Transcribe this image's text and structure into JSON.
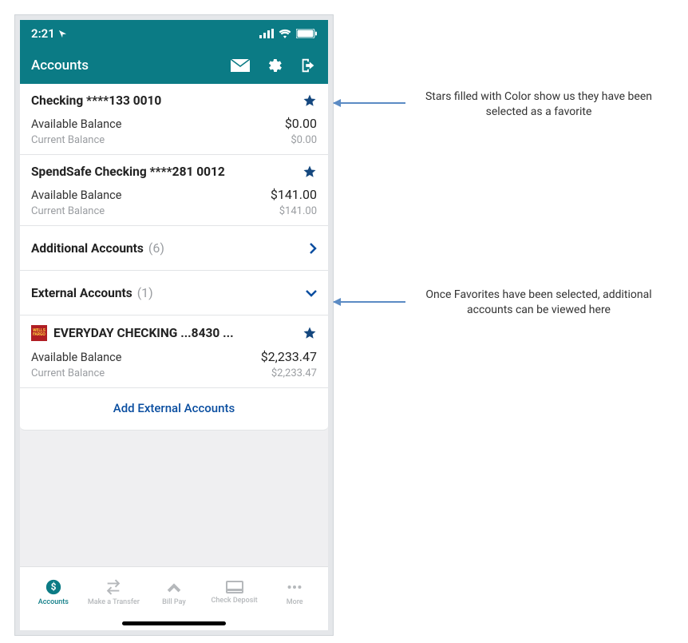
{
  "statusBar": {
    "time": "2:21"
  },
  "header": {
    "title": "Accounts"
  },
  "accounts": [
    {
      "name": "Checking ****133 0010",
      "favorite": true,
      "availLabel": "Available Balance",
      "availVal": "$0.00",
      "currLabel": "Current Balance",
      "currVal": "$0.00"
    },
    {
      "name": "SpendSafe Checking ****281 0012",
      "favorite": true,
      "availLabel": "Available Balance",
      "availVal": "$141.00",
      "currLabel": "Current Balance",
      "currVal": "$141.00"
    }
  ],
  "additional": {
    "label": "Additional Accounts",
    "count": "(6)"
  },
  "external": {
    "label": "External Accounts",
    "count": "(1)"
  },
  "externalAccount": {
    "badge": "WELLS FARGO",
    "name": "EVERYDAY CHECKING ...8430 ...",
    "favorite": true,
    "availLabel": "Available Balance",
    "availVal": "$2,233.47",
    "currLabel": "Current Balance",
    "currVal": "$2,233.47"
  },
  "addExternal": "Add External Accounts",
  "nav": {
    "accounts": "Accounts",
    "transfer": "Make a Transfer",
    "billpay": "Bill Pay",
    "deposit": "Check Deposit",
    "more": "More"
  },
  "annotations": {
    "a1": "Stars filled with Color show us they have been selected as a favorite",
    "a2": "Once Favorites have been selected, additional accounts can be viewed here"
  },
  "colors": {
    "teal": "#0b7b85",
    "starBlue": "#14477e",
    "arrowBlue": "#5b8bc4",
    "linkBlue": "#0a4ea0"
  }
}
